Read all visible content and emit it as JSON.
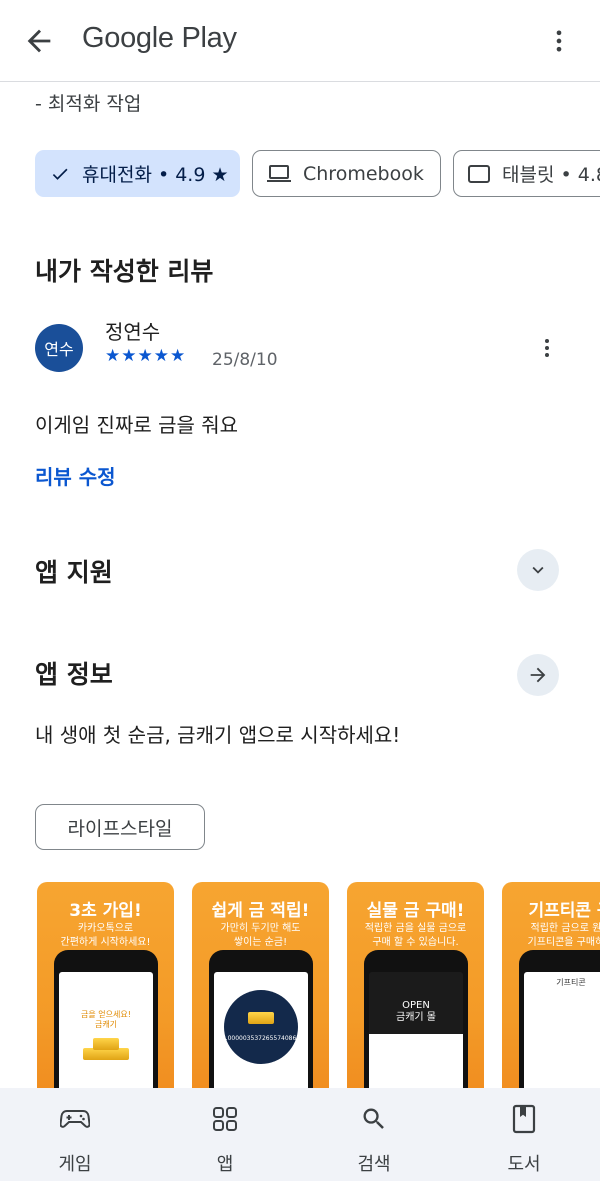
{
  "header": {
    "title": "Google Play",
    "back_icon": "arrow-back-icon",
    "more_icon": "more-vert-icon"
  },
  "whats_new": {
    "line": "- 최적화 작업"
  },
  "device_chips": [
    {
      "label": "휴대전화 • 4.9 ★",
      "icon": "check-icon",
      "selected": true
    },
    {
      "label": "Chromebook",
      "icon": "laptop-icon",
      "selected": false
    },
    {
      "label": "태블릿 • 4.8",
      "icon": "tablet-icon",
      "selected": false
    }
  ],
  "my_review": {
    "section_title": "내가 작성한 리뷰",
    "avatar_text": "연수",
    "reviewer": "정연수",
    "stars": "★★★★★",
    "rating": 5,
    "date": "25/8/10",
    "text": "이게임 진짜로 금을 줘요",
    "edit_label": "리뷰 수정"
  },
  "app_support": {
    "title": "앱 지원"
  },
  "app_info": {
    "title": "앱 정보",
    "description": "내 생애 첫 순금, 금캐기 앱으로 시작하세요!",
    "tag": "라이프스타일"
  },
  "screenshots": [
    {
      "title": "3초 가입!",
      "subtitle": "카카오톡으로\n간편하게 시작하세요!",
      "screen_text": "금을 얻으세요!\n금캐기"
    },
    {
      "title": "쉽게 금 적립!",
      "subtitle": "가만히 두기만 해도\n쌓이는 순금!",
      "screen_text": "0.000003537265574086g"
    },
    {
      "title": "실물 금 구매!",
      "subtitle": "적립한 금을 실물 금으로\n구매 할 수 있습니다.",
      "screen_text": "OPEN\n금캐기 몰"
    },
    {
      "title": "기프티콘 구",
      "subtitle": "적립한 금으로 원하\n기프티콘을 구매하세",
      "screen_text": "기프티콘"
    }
  ],
  "bottom_nav": [
    {
      "label": "게임",
      "icon": "gamepad-icon"
    },
    {
      "label": "앱",
      "icon": "apps-grid-icon"
    },
    {
      "label": "검색",
      "icon": "search-icon"
    },
    {
      "label": "도서",
      "icon": "book-icon"
    }
  ],
  "colors": {
    "accent_blue": "#0b57d0",
    "selected_chip_bg": "#d3e3fd",
    "avatar_bg": "#1a4f99",
    "nav_bg": "#f1f3f8",
    "screenshot_orange": "#f39a27"
  }
}
